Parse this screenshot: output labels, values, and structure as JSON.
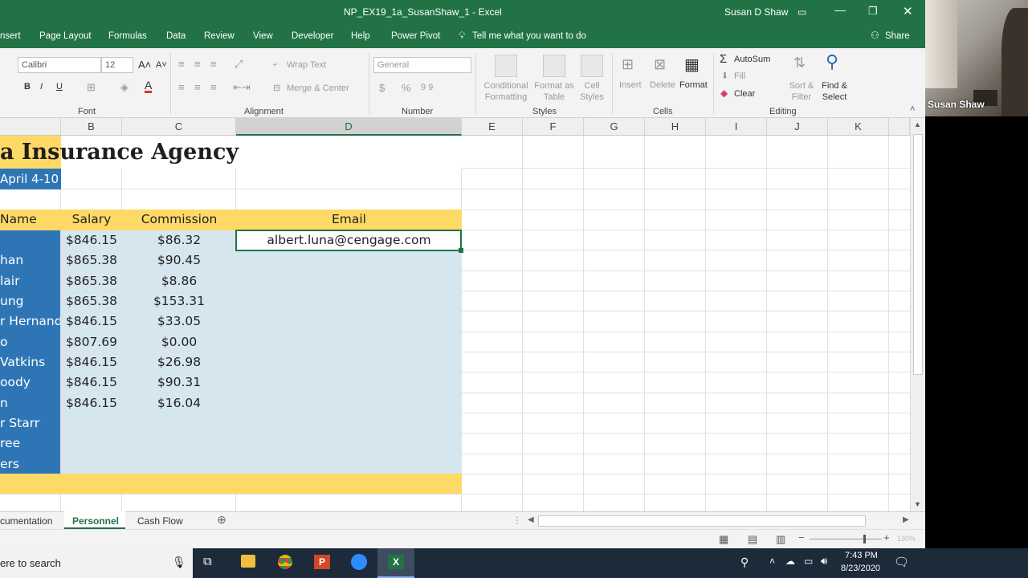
{
  "window": {
    "title": "NP_EX19_1a_SusanShaw_1  -  Excel",
    "user": "Susan D Shaw"
  },
  "menu": {
    "items": [
      "nsert",
      "Page Layout",
      "Formulas",
      "Data",
      "Review",
      "View",
      "Developer",
      "Help",
      "Power Pivot"
    ],
    "tell_me": "Tell me what you want to do",
    "share": "Share"
  },
  "ribbon": {
    "font_name": "Calibri",
    "font_size": "12",
    "wrap_text": "Wrap Text",
    "merge_center": "Merge & Center",
    "number_format": "General",
    "conditional_formatting": "Conditional Formatting",
    "format_as_table": "Format as Table",
    "cell_styles": "Cell Styles",
    "insert": "Insert",
    "delete": "Delete",
    "format": "Format",
    "autosum": "AutoSum",
    "fill": "Fill",
    "clear": "Clear",
    "sort_filter": "Sort & Filter",
    "find_select": "Find & Select",
    "groups": {
      "font": "Font",
      "alignment": "Alignment",
      "number": "Number",
      "styles": "Styles",
      "cells": "Cells",
      "editing": "Editing"
    }
  },
  "columns": [
    "B",
    "C",
    "D",
    "E",
    "F",
    "G",
    "H",
    "I",
    "J",
    "K"
  ],
  "sheet": {
    "title": "a Insurance Agency",
    "subtitle": "April 4-10",
    "headers": {
      "name": "Name",
      "salary": "Salary",
      "commission": "Commission",
      "email": "Email"
    },
    "rows": [
      {
        "name": "",
        "salary": "$846.15",
        "commission": "$86.32",
        "email": "albert.luna@cengage.com"
      },
      {
        "name": "han",
        "salary": "$865.38",
        "commission": "$90.45",
        "email": ""
      },
      {
        "name": "lair",
        "salary": "$865.38",
        "commission": "$8.86",
        "email": ""
      },
      {
        "name": "ung",
        "salary": "$865.38",
        "commission": "$153.31",
        "email": ""
      },
      {
        "name": "r Hernand",
        "salary": "$846.15",
        "commission": "$33.05",
        "email": ""
      },
      {
        "name": "o",
        "salary": "$807.69",
        "commission": "$0.00",
        "email": ""
      },
      {
        "name": "Vatkins",
        "salary": "$846.15",
        "commission": "$26.98",
        "email": ""
      },
      {
        "name": "oody",
        "salary": "$846.15",
        "commission": "$90.31",
        "email": ""
      },
      {
        "name": "n",
        "salary": "$846.15",
        "commission": "$16.04",
        "email": ""
      },
      {
        "name": "r Starr",
        "salary": "",
        "commission": "",
        "email": ""
      },
      {
        "name": "ree",
        "salary": "",
        "commission": "",
        "email": ""
      },
      {
        "name": "ers",
        "salary": "",
        "commission": "",
        "email": ""
      }
    ]
  },
  "tabs": {
    "items": [
      "cumentation",
      "Personnel",
      "Cash Flow"
    ],
    "active": "Personnel"
  },
  "status": {
    "zoom": "130%"
  },
  "taskbar": {
    "search": "ere to search",
    "time": "7:43 PM",
    "date": "8/23/2020"
  },
  "webcam": {
    "name": "Susan Shaw"
  },
  "colors": {
    "excel_green": "#217346",
    "header_yellow": "#ffd966",
    "row_blue": "#d6e6ef",
    "name_col": "#2e75b6"
  }
}
